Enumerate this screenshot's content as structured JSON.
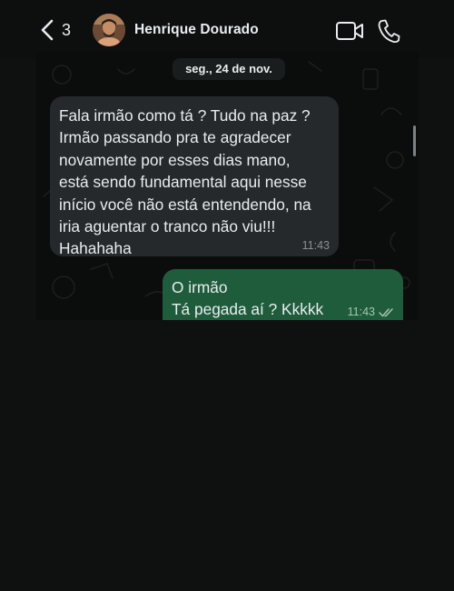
{
  "header": {
    "back_count": "3",
    "contact_name": "Henrique Dourado"
  },
  "chat": {
    "date_label": "seg., 24 de nov.",
    "messages": [
      {
        "direction": "incoming",
        "text": "Fala irmão como tá ? Tudo na paz ?\nIrmão passando pra te agradecer\nnovamente por esses dias mano,\nestá sendo fundamental aqui nesse\ninício você não está entendendo, na\niria aguentar o tranco não viu!!!\nHahahaha",
        "time": "11:43"
      },
      {
        "direction": "outgoing",
        "text": "O irmão\nTá pegada aí ? Kkkkk",
        "time": "11:43",
        "status": "read"
      }
    ]
  },
  "colors": {
    "background": "#0f1111",
    "incoming_bubble": "#26292b",
    "outgoing_bubble": "#1f5c3c",
    "text": "#e9edef"
  },
  "icons": {
    "back": "chevron-left-icon",
    "video": "video-camera-icon",
    "call": "phone-icon",
    "read_receipt": "double-check-icon"
  }
}
